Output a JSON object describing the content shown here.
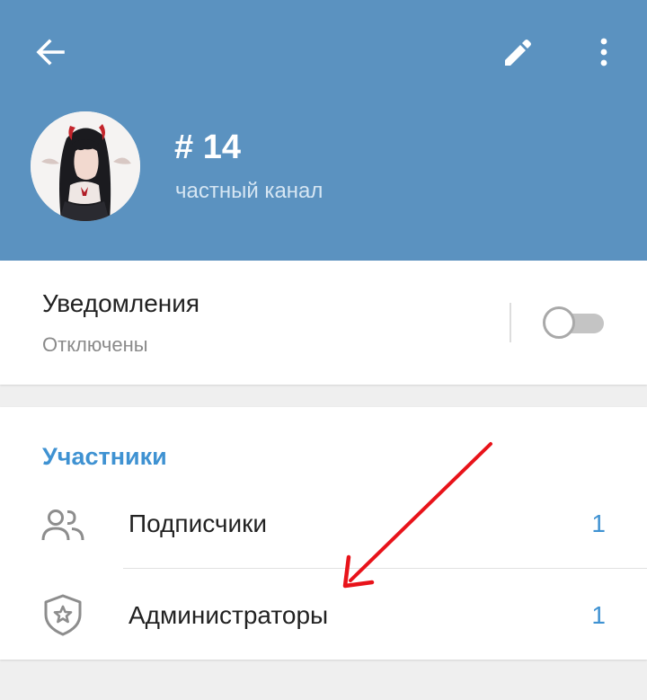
{
  "header": {
    "back_icon": "back-arrow-icon",
    "edit_icon": "pencil-icon",
    "more_icon": "more-vertical-icon",
    "title": "# 14",
    "subtitle": "частный канал",
    "color": "#5b92c0"
  },
  "notifications": {
    "title": "Уведомления",
    "status": "Отключены",
    "toggle_on": false
  },
  "members": {
    "section_title": "Участники",
    "rows": [
      {
        "label": "Подписчики",
        "count": "1",
        "icon": "users-icon"
      },
      {
        "label": "Администраторы",
        "count": "1",
        "icon": "admin-shield-icon"
      }
    ]
  },
  "colors": {
    "accent": "#3f92d2",
    "annotation_arrow": "#e8131a"
  }
}
